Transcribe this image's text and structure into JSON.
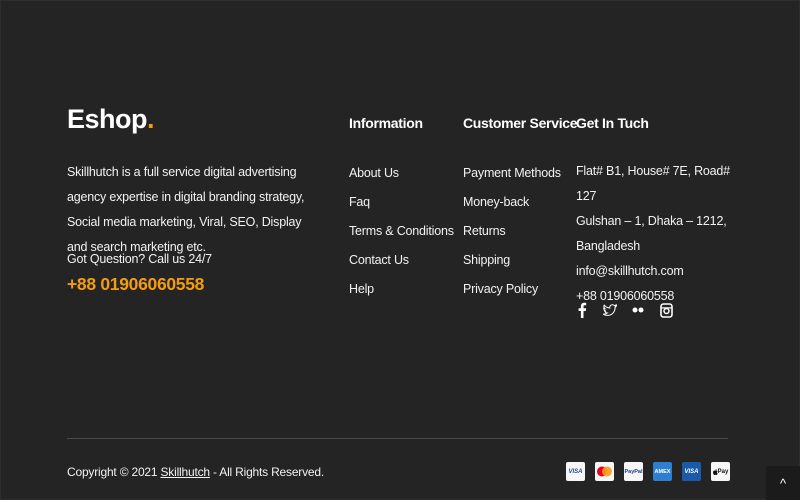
{
  "brand": {
    "logo_text": "Eshop",
    "logo_dot": "."
  },
  "about": {
    "description": "Skillhutch is a full service digital advertising agency expertise in digital branding strategy, Social media marketing, Viral, SEO, Display and search marketing etc.",
    "question": "Got Question? Call us 24/7",
    "phone": "+88 01906060558"
  },
  "information": {
    "title": "Information",
    "links": [
      "About Us",
      "Faq",
      "Terms & Conditions",
      "Contact Us",
      "Help"
    ]
  },
  "customer_service": {
    "title": "Customer Service",
    "links": [
      "Payment Methods",
      "Money-back",
      "Returns",
      "Shipping",
      "Privacy Policy"
    ]
  },
  "contact": {
    "title": "Get In Tuch",
    "address_line1": "Flat# B1, House# 7E, Road# 127",
    "address_line2": "Gulshan – 1, Dhaka – 1212,",
    "address_line3": "Bangladesh",
    "email": "info@skillhutch.com",
    "phone": "+88 01906060558"
  },
  "social": [
    "facebook-icon",
    "twitter-icon",
    "flickr-icon",
    "instagram-icon"
  ],
  "footer": {
    "copyright_prefix": "Copyright © 2021 ",
    "copyright_link": "Skillhutch",
    "copyright_suffix": " - All Rights Reserved."
  },
  "payment_cards": {
    "visa": "VISA",
    "paypal": "PayPal",
    "amex": "AMEX",
    "visa2": "VISA",
    "applepay": "Pay"
  },
  "scroll_top": "^",
  "colors": {
    "background": "#242424",
    "accent": "#f39c12",
    "text": "#f2f2f2"
  }
}
